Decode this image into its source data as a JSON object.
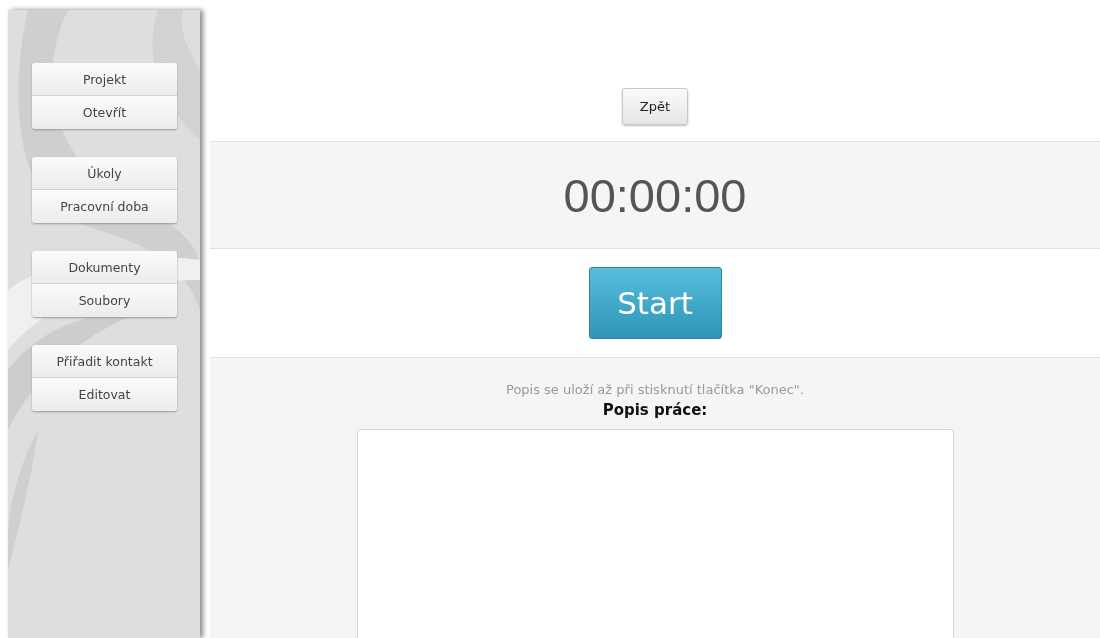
{
  "sidebar": {
    "groups": [
      {
        "items": [
          "Projekt",
          "Otevřít"
        ]
      },
      {
        "items": [
          "Úkoly",
          "Pracovní doba"
        ]
      },
      {
        "items": [
          "Dokumenty",
          "Soubory"
        ]
      },
      {
        "items": [
          "Přiřadit kontakt",
          "Editovat"
        ]
      }
    ]
  },
  "back_button": "Zpět",
  "timer": "00:00:00",
  "start_button": "Start",
  "description": {
    "note": "Popis se uloží až při stisknutí tlačítka \"Konec\".",
    "label": "Popis práce:"
  }
}
